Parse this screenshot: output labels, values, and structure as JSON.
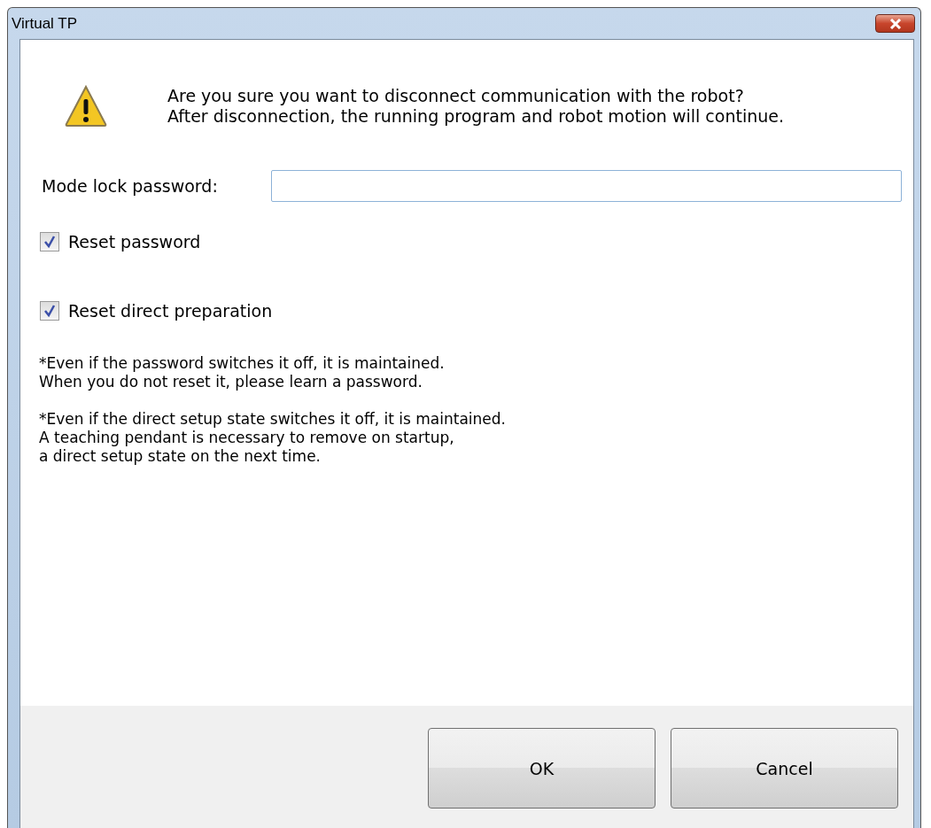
{
  "window": {
    "title": "Virtual TP"
  },
  "message": "Are you sure you want to disconnect communication with the robot?\nAfter disconnection, the running program and robot motion will continue.",
  "password_field": {
    "label": "Mode lock password:"
  },
  "checkboxes": [
    {
      "label": "Reset password",
      "checked": true
    },
    {
      "label": "Reset direct preparation",
      "checked": true
    }
  ],
  "notes": [
    "*Even if the password switches it off, it is maintained.\nWhen you do not reset it, please learn a password.",
    "*Even if the direct setup state switches it off, it is maintained.\nA teaching pendant is necessary to remove on startup,\na direct setup state on the next time."
  ],
  "buttons": [
    "OK",
    "Cancel"
  ]
}
